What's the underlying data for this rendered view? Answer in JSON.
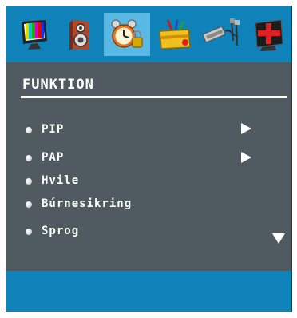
{
  "tabs": [
    {
      "name": "picture",
      "icon": "tv-icon"
    },
    {
      "name": "sound",
      "icon": "speaker-icon"
    },
    {
      "name": "function",
      "icon": "alarm-clock-icon",
      "active": true
    },
    {
      "name": "settings",
      "icon": "toolbox-icon"
    },
    {
      "name": "source",
      "icon": "cables-icon"
    },
    {
      "name": "channels",
      "icon": "red-cross-icon"
    }
  ],
  "menu": {
    "title": "FUNKTION",
    "items": [
      {
        "label": "PIP",
        "has_submenu": true
      },
      {
        "label": "PAP",
        "has_submenu": true
      },
      {
        "label": "Hvile",
        "has_submenu": false
      },
      {
        "label": "Búrnesikring",
        "has_submenu": false
      },
      {
        "label": "Sprog",
        "has_submenu": false
      }
    ],
    "more_indicator": "scroll-down"
  },
  "colors": {
    "panel": "#4f5b61",
    "bar": "#0e82b9",
    "active_tab": "#5ab9e4",
    "text": "#ffffff"
  }
}
